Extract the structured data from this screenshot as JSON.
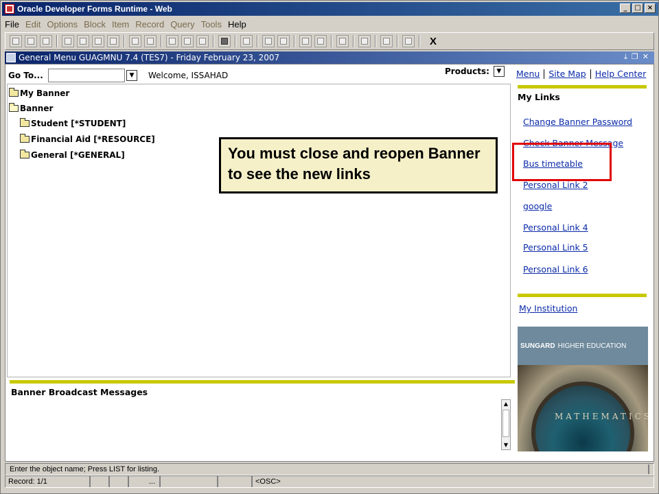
{
  "window": {
    "title": "Oracle Developer Forms Runtime - Web"
  },
  "menubar": {
    "items": [
      {
        "label": "File",
        "dim": false
      },
      {
        "label": "Edit",
        "dim": true
      },
      {
        "label": "Options",
        "dim": true
      },
      {
        "label": "Block",
        "dim": true
      },
      {
        "label": "Item",
        "dim": true
      },
      {
        "label": "Record",
        "dim": true
      },
      {
        "label": "Query",
        "dim": true
      },
      {
        "label": "Tools",
        "dim": true
      },
      {
        "label": "Help",
        "dim": false
      }
    ]
  },
  "toolbar": {
    "exit_label": "X"
  },
  "form": {
    "title": "General Menu  GUAGMNU  7.4  (TES7) - Friday February 23, 2007",
    "goto_label": "Go To...",
    "goto_value": "",
    "welcome": "Welcome, ISSAHAD",
    "products_label": "Products:"
  },
  "nav": {
    "menu": "Menu",
    "site_map": "Site Map",
    "help_center": "Help Center"
  },
  "tree": [
    {
      "label": "My Banner"
    },
    {
      "label": "Banner"
    },
    {
      "label": "Student [*STUDENT]"
    },
    {
      "label": "Financial Aid [*RESOURCE]"
    },
    {
      "label": "General [*GENERAL]"
    }
  ],
  "callout": {
    "text": "You must close and reopen Banner to see the new links"
  },
  "my_links": {
    "title": "My Links",
    "items": [
      "Change Banner Password",
      "Check Banner Message",
      "Bus timetable",
      "Personal Link 2",
      "google",
      "Personal Link 4",
      "Personal Link 5",
      "Personal Link 6"
    ]
  },
  "institution": {
    "link": "My Institution"
  },
  "promo": {
    "brand": "SUNGARD",
    "tagline": "HIGHER EDUCATION",
    "dome_text": "MATHEMATICS"
  },
  "broadcast": {
    "title": "Banner Broadcast Messages"
  },
  "status": {
    "hint": "Enter the object name; Press LIST for listing.",
    "record": "Record: 1/1",
    "ellipsis": "...",
    "osc": "<OSC>"
  }
}
